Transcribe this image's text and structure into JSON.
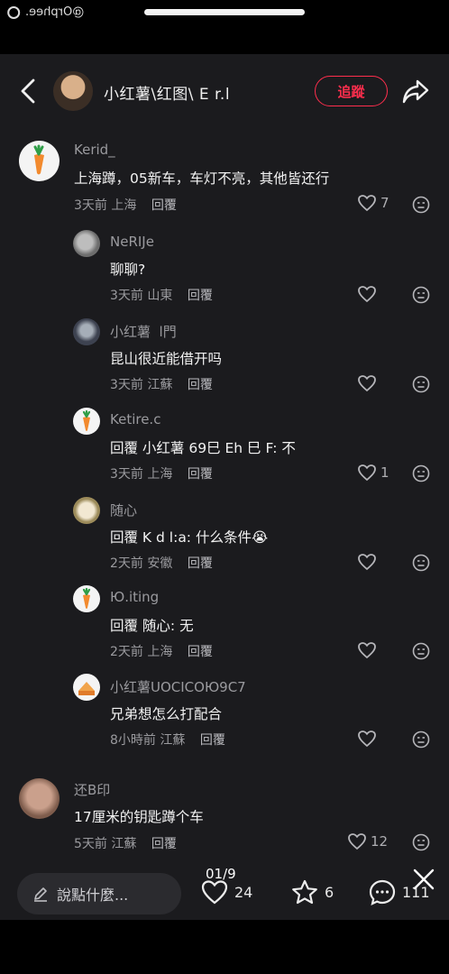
{
  "status": {
    "watermark": "@Orphee."
  },
  "header": {
    "username": "小红薯\\红图\\ E r.l",
    "follow_label": "追蹤",
    "icons": {
      "back": "chevron-left-icon",
      "share": "share-arrow-icon"
    }
  },
  "comments": [
    {
      "id": "c1",
      "level": "top",
      "avatar": "carrot",
      "user": "Kerid_",
      "text": "上海蹲，05新车，车灯不亮，其他皆还行",
      "time": "3天前",
      "location": "上海",
      "reply_label": "回覆",
      "likes": "7"
    },
    {
      "id": "c2",
      "level": "sub",
      "avatar": "gray",
      "user": "NeRIJe",
      "text": "聊聊?",
      "time": "3天前",
      "location": "山東",
      "reply_label": "回覆",
      "likes": ""
    },
    {
      "id": "c3",
      "level": "sub",
      "avatar": "dark",
      "user": "小红薯  l門  ",
      "text": "昆山很近能借开吗",
      "time": "3天前",
      "location": "江蘇",
      "reply_label": "回覆",
      "likes": ""
    },
    {
      "id": "c4",
      "level": "sub",
      "avatar": "carrot",
      "user": "Ketire.c",
      "text": "回覆 小红薯 69巳 Eh 巳 F: 不",
      "time": "3天前",
      "location": "上海",
      "reply_label": "回覆",
      "likes": "1"
    },
    {
      "id": "c5",
      "level": "sub",
      "avatar": "dog",
      "user": "随心",
      "text": "回覆 K d l:a: 什么条件😭",
      "time": "2天前",
      "location": "安徽",
      "reply_label": "回覆",
      "likes": ""
    },
    {
      "id": "c6",
      "level": "sub",
      "avatar": "carrot",
      "user": "Ю.iting",
      "text": "回覆 随心: 无",
      "time": "2天前",
      "location": "上海",
      "reply_label": "回覆",
      "likes": ""
    },
    {
      "id": "c7",
      "level": "sub",
      "avatar": "cake",
      "user": "小红薯UOCICOЮ9C7",
      "text": "兄弟想怎么打配合",
      "time": "8小時前",
      "location": "江蘇",
      "reply_label": "回覆",
      "likes": ""
    },
    {
      "id": "c8",
      "level": "top",
      "avatar": "man",
      "user": "还B印",
      "text": "17厘米的钥匙蹲个车",
      "time": "5天前",
      "location": "江蘇",
      "reply_label": "回覆",
      "likes": "12"
    }
  ],
  "bottom": {
    "input_placeholder": "說點什麼...",
    "likes": "24",
    "stars": "6",
    "comments": "111",
    "pager": "01/9",
    "icons": {
      "input": "pencil-icon",
      "like": "heart-icon",
      "star": "star-icon",
      "comment": "comment-bubble-icon",
      "close": "close-icon"
    }
  },
  "colors": {
    "accent": "#ff2e4d",
    "background": "#1b1b1e"
  }
}
